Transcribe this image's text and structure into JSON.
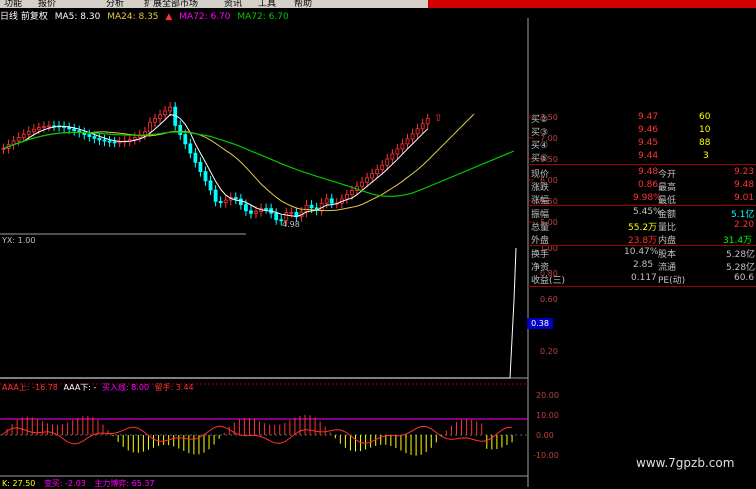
{
  "menu": [
    "功能",
    "报价",
    "分析",
    "扩展全部市场",
    "资讯",
    "工具",
    "帮助"
  ],
  "toolbar_icons": [
    "arrow-up-icon"
  ],
  "main": {
    "title": "日线 前复权",
    "ma5": "MA5: 8.30",
    "ma24": "MA24: 8.35",
    "ma72a": "MA72: 6.70",
    "ma72b": "MA72: 6.70",
    "low_label": "4.98",
    "y_ticks": [
      "7.50",
      "7.00",
      "6.50",
      "6.00",
      "5.50",
      "5.00"
    ]
  },
  "yx": {
    "title": "YX: 1.00",
    "y_ticks": [
      "1.00",
      "0.80",
      "0.60",
      "0.40",
      "0.20"
    ],
    "cursor_value": "0.38"
  },
  "aaa": {
    "aaa_up": "AAA上: -16.78",
    "aaa_down": "AAA下: -",
    "buy_line": "买入线: 8.00",
    "pay_attention": "留手: 3.44",
    "y_ticks": [
      "20.00",
      "10.00",
      "0.00",
      "-10.00"
    ]
  },
  "bottom": {
    "a": "K: 27.50",
    "b": "变买: -2.03",
    "c": "主力博弈: 65.37"
  },
  "quote": {
    "orders": [
      {
        "label": "买②",
        "price": "9.47",
        "vol": "60"
      },
      {
        "label": "买③",
        "price": "9.46",
        "vol": "10"
      },
      {
        "label": "买④",
        "price": "9.45",
        "vol": "88"
      },
      {
        "label": "买⑤",
        "price": "9.44",
        "vol": "3"
      }
    ],
    "stats": [
      {
        "l1": "现价",
        "v1": "9.48",
        "l2": "今开",
        "v2": "9.23"
      },
      {
        "l1": "涨跌",
        "v1": "0.86",
        "l2": "最高",
        "v2": "9.48"
      },
      {
        "l1": "涨幅",
        "v1": "9.98%",
        "l2": "最低",
        "v2": "9.01"
      },
      {
        "l1": "振幅",
        "v1": "5.45%",
        "l2": "金额",
        "v2": "5.1亿"
      },
      {
        "l1": "总量",
        "v1": "55.2万",
        "l2": "量比",
        "v2": "2.20"
      },
      {
        "l1": "外盘",
        "v1": "23.8万",
        "l2": "内盘",
        "v2": "31.4万"
      },
      {
        "l1": "换手",
        "v1": "10.47%",
        "l2": "股本",
        "v2": "5.28亿"
      },
      {
        "l1": "净资",
        "v1": "2.85",
        "l2": "流通",
        "v2": "5.28亿"
      },
      {
        "l1": "收益(三)",
        "v1": "0.117",
        "l2": "PE(动)",
        "v2": "60.6"
      }
    ]
  },
  "watermark": "www.7gpzb.com",
  "colors": {
    "up": "#ff3232",
    "down": "#00ffff",
    "ma5": "#ffffff",
    "ma24": "#e6c84a",
    "ma72": "#00c800",
    "magenta": "#ff00ff",
    "yellow": "#ffff00"
  }
}
